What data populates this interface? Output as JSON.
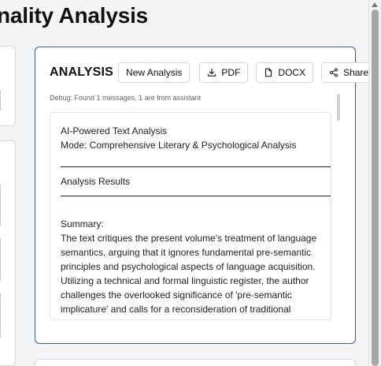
{
  "page": {
    "title": "nality Analysis"
  },
  "panel": {
    "title": "ANALYSIS",
    "buttons": {
      "new_analysis": "New Analysis",
      "pdf": "PDF",
      "docx": "DOCX",
      "share": "Share"
    },
    "debug": "Debug: Found 1 messages, 1 are from assistant",
    "content": {
      "line1": "AI-Powered Text Analysis",
      "line2": "Mode: Comprehensive Literary & Psychological Analysis",
      "section_heading": "Analysis Results",
      "summary_label": "Summary:",
      "summary_lines": [
        "The text critiques the present volume's treatment of language",
        "semantics, arguing that it ignores fundamental pre-semantic",
        "principles and psychological aspects of language acquisition.",
        "Utilizing a technical and formal linguistic register, the author",
        "challenges the overlooked significance of 'pre-semantic",
        "implicature' and calls for a reconsideration of traditional"
      ]
    }
  },
  "icons": {
    "pdf": "download-icon",
    "docx": "document-icon",
    "share": "share-icon"
  },
  "colors": {
    "panel_border": "#3e5f8a",
    "background": "#f3f4f6"
  }
}
